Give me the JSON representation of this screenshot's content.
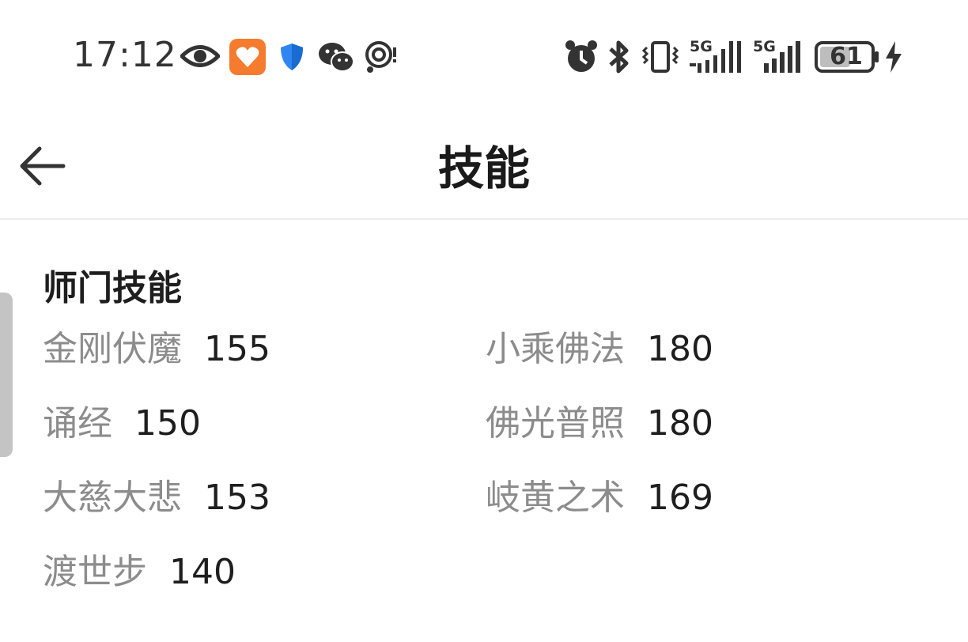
{
  "status_bar": {
    "time": "17:12",
    "icons": [
      "eye-icon",
      "health-app-icon",
      "shield-icon",
      "wechat-icon",
      "location-icon",
      "alarm-icon",
      "bluetooth-icon",
      "vibrate-icon",
      "signal-icon",
      "signal-icon",
      "battery-icon",
      "charging-icon"
    ],
    "network_1": "5G",
    "network_2": "5G",
    "battery": "61",
    "colors": {
      "health_app": "#f57c2e",
      "shield": "#2f86f0"
    }
  },
  "header": {
    "title": "技能",
    "back_icon": "arrow-left-icon"
  },
  "section": {
    "title": "师门技能",
    "skills": [
      {
        "name": "金刚伏魔",
        "value": "155"
      },
      {
        "name": "小乘佛法",
        "value": "180"
      },
      {
        "name": "诵经",
        "value": "150"
      },
      {
        "name": "佛光普照",
        "value": "180"
      },
      {
        "name": "大慈大悲",
        "value": "153"
      },
      {
        "name": "岐黄之术",
        "value": "169"
      },
      {
        "name": "渡世步",
        "value": "140"
      }
    ]
  }
}
